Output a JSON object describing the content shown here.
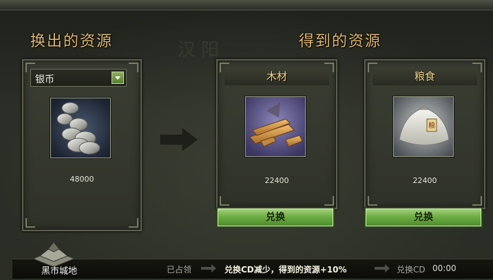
{
  "left_heading": "换出的资源",
  "right_heading": "得到的资源",
  "watermark": "汉阳",
  "source": {
    "selected": "银币",
    "icon": "silver-coins-icon",
    "amount": "48000"
  },
  "targets": [
    {
      "name": "木材",
      "icon": "wood-icon",
      "amount": "22400",
      "button": "兑换"
    },
    {
      "name": "粮食",
      "icon": "grain-sack-icon",
      "amount": "22400",
      "button": "兑换"
    }
  ],
  "footer": {
    "city": "黑市城地",
    "occupied": "已占领",
    "bonus": "兑换CD减少，得到的资源+10%",
    "cd_label": "兑换CD",
    "cd_time": "00:00"
  }
}
